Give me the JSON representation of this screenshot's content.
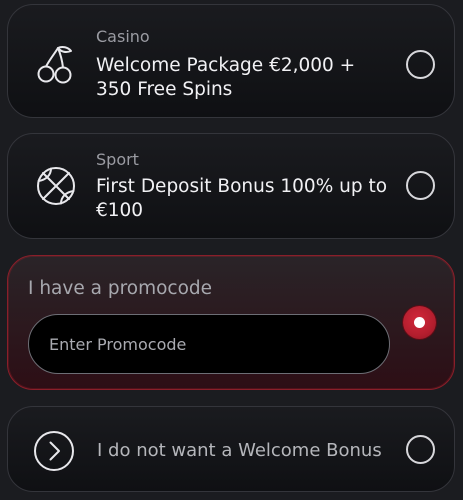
{
  "options": {
    "casino": {
      "category": "Casino",
      "title": "Welcome Package €2,000 + 350 Free Spins",
      "icon": "cherries-icon",
      "selected": false
    },
    "sport": {
      "category": "Sport",
      "title": "First Deposit Bonus 100% up to €100",
      "icon": "basketball-icon",
      "selected": false
    },
    "promocode": {
      "label": "I have a promocode",
      "input_value": "",
      "input_placeholder": "Enter Promocode",
      "selected": true
    },
    "no_bonus": {
      "label": "I do not want a Welcome Bonus",
      "icon": "chevron-right-circle-icon",
      "selected": false
    }
  },
  "colors": {
    "background": "#1b1c20",
    "accent": "#c4222f",
    "card_border": "#34353b",
    "selected_border": "#8a1f2a"
  }
}
